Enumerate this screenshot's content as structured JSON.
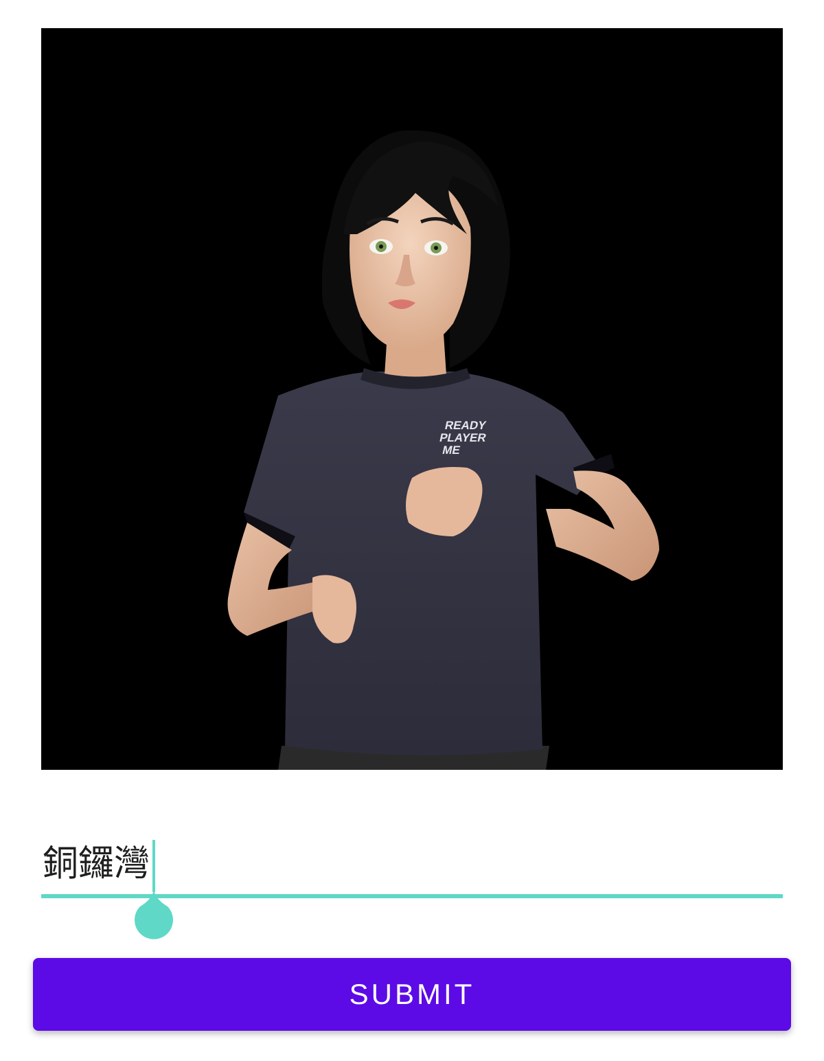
{
  "avatar_view": {
    "background_color": "#000000",
    "shirt_print": [
      "READY",
      "PLAYER",
      "ME"
    ]
  },
  "text_input": {
    "value": "銅鑼灣",
    "accent_color": "#5fd8c7"
  },
  "submit_button": {
    "label": "SUBMIT",
    "color": "#5c0be6"
  }
}
